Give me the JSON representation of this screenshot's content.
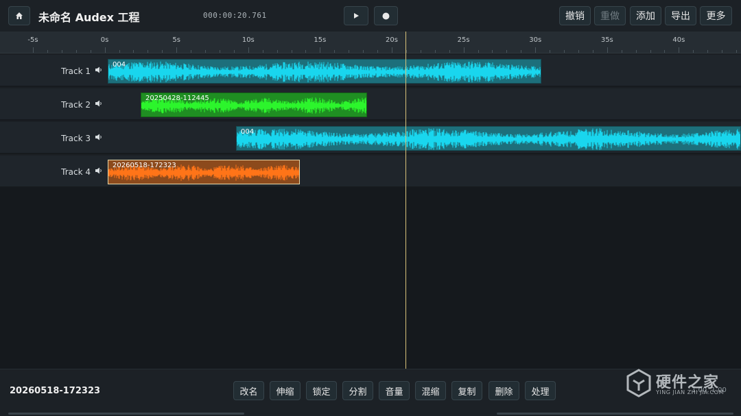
{
  "header": {
    "home_icon": "home-icon",
    "title": "未命名 Audex 工程",
    "timecode": "000:00:20.761",
    "play_icon": "play-icon",
    "record_icon": "record-icon",
    "undo_label": "撤销",
    "redo_label": "重做",
    "add_label": "添加",
    "export_label": "导出",
    "more_label": "更多"
  },
  "ruler": {
    "ticks": [
      "-5s",
      "0s",
      "5s",
      "10s",
      "15s",
      "20s",
      "25s",
      "30s",
      "35s",
      "40s"
    ]
  },
  "tracks": [
    {
      "name": "Track 1",
      "clip": {
        "label": "004",
        "color": "#19d6ee",
        "bg": "#1d6f7b"
      }
    },
    {
      "name": "Track 2",
      "clip": {
        "label": "20250428-112445",
        "color": "#2cf52c",
        "bg": "#1f8e22"
      }
    },
    {
      "name": "Track 3",
      "clip": {
        "label": "004",
        "color": "#19d6ee",
        "bg": "#1d6f7b"
      }
    },
    {
      "name": "Track 4",
      "clip": {
        "label": "20260518-172323",
        "color": "#ff7418",
        "bg": "#8c4a1c"
      }
    }
  ],
  "playhead_time": "20.761",
  "bottom": {
    "selected_clip": "20260518-172323",
    "actions": [
      "改名",
      "伸缩",
      "锁定",
      "分割",
      "音量",
      "混缩",
      "复制",
      "删除",
      "处理"
    ],
    "zoom_readout": "1.00, 1.00"
  },
  "watermark": {
    "text": "硬件之家",
    "sub": "YING JIAN ZHI JIA.COM"
  }
}
